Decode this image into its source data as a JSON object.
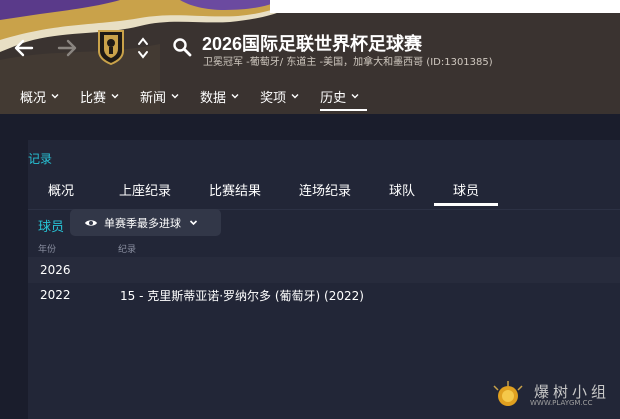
{
  "header": {
    "title": "2026国际足联世界杯足球赛",
    "subtitle": "卫冕冠军 -葡萄牙/ 东道主 -美国，加拿大和墨西哥 (ID:1301385)",
    "icons": {
      "back": "arrow-left-icon",
      "forward": "arrow-right-icon",
      "crest": "competition-crest-icon",
      "switcher": "up-down-chevron-icon",
      "search": "search-icon"
    }
  },
  "menu": [
    {
      "label": "概况",
      "active": false
    },
    {
      "label": "比赛",
      "active": false
    },
    {
      "label": "新闻",
      "active": false
    },
    {
      "label": "数据",
      "active": false
    },
    {
      "label": "奖项",
      "active": false
    },
    {
      "label": "历史",
      "active": true
    }
  ],
  "records": {
    "section_label": "记录",
    "tabs": [
      {
        "label": "概况",
        "active": false
      },
      {
        "label": "上座纪录",
        "active": false
      },
      {
        "label": "比赛结果",
        "active": false
      },
      {
        "label": "连场纪录",
        "active": false
      },
      {
        "label": "球队",
        "active": false
      },
      {
        "label": "球员",
        "active": true
      }
    ],
    "player_label": "球员",
    "filter": {
      "value": "单赛季最多进球"
    },
    "columns": {
      "year": "年份",
      "record": "纪录"
    },
    "rows": [
      {
        "year": "2026",
        "record": ""
      },
      {
        "year": "2022",
        "record": "15 - 克里斯蒂亚诺·罗纳尔多 (葡萄牙) (2022)"
      }
    ]
  },
  "watermark": {
    "text": "爆树小组",
    "url": "WWW.PLAYGM.CC"
  },
  "colors": {
    "accent": "#27c3d6",
    "background": "#1a1d2c",
    "panel": "#222637",
    "header": "#3a3330",
    "gold": "#c9a24a"
  }
}
